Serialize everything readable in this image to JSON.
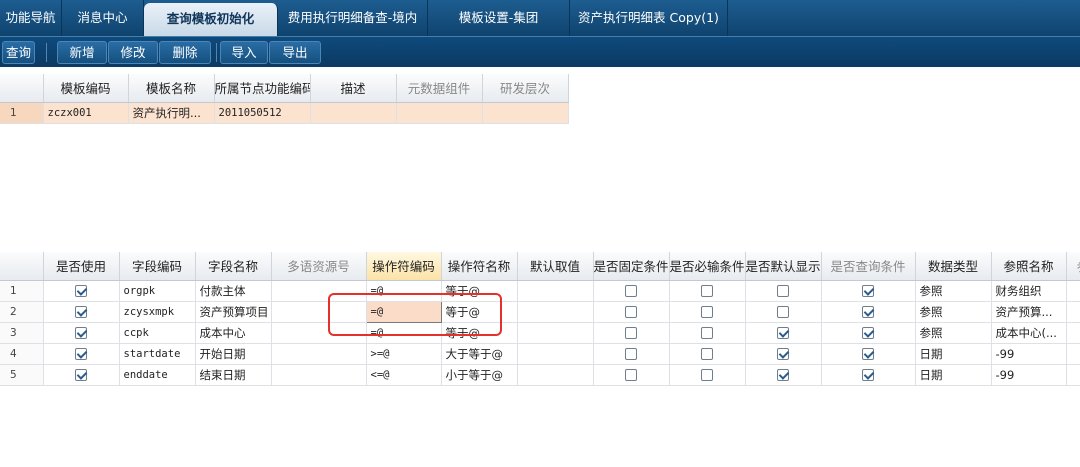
{
  "tabs": [
    {
      "label": "功能导航"
    },
    {
      "label": "消息中心"
    },
    {
      "label": "查询模板初始化",
      "active": true
    },
    {
      "label": "费用执行明细备查-境内"
    },
    {
      "label": "模板设置-集团"
    },
    {
      "label": "资产执行明细表 Copy(1)"
    }
  ],
  "toolbar": {
    "query": "查询",
    "add": "新增",
    "edit": "修改",
    "delete": "删除",
    "import": "导入",
    "export": "导出"
  },
  "template_grid": {
    "headers": [
      "模板编码",
      "模板名称",
      "所属节点功能编码",
      "描述",
      "元数据组件",
      "研发层次"
    ],
    "rows": [
      {
        "num": "1",
        "code": "zczx001",
        "name": "资产执行明...",
        "node": "2011050512",
        "desc": "",
        "meta": "",
        "level": ""
      }
    ]
  },
  "field_grid": {
    "headers": [
      "是否使用",
      "字段编码",
      "字段名称",
      "多语资源号",
      "操作符编码",
      "操作符名称",
      "默认取值",
      "是否固定条件",
      "是否必输条件",
      "是否默认显示",
      "是否查询条件",
      "数据类型",
      "参照名称",
      "参"
    ],
    "rows": [
      {
        "num": "1",
        "used": true,
        "code": "orgpk",
        "name": "付款主体",
        "res": "",
        "op": "=@",
        "opname": "等于@",
        "def": "",
        "fixed": false,
        "required": false,
        "show": false,
        "query": true,
        "type": "参照",
        "ref": "财务组织"
      },
      {
        "num": "2",
        "used": true,
        "code": "zcysxmpk",
        "name": "资产预算项目",
        "res": "",
        "op": "=@",
        "opname": "等于@",
        "def": "",
        "fixed": false,
        "required": false,
        "show": false,
        "query": true,
        "type": "参照",
        "ref": "资产预算..."
      },
      {
        "num": "3",
        "used": true,
        "code": "ccpk",
        "name": "成本中心",
        "res": "",
        "op": "=@",
        "opname": "等于@",
        "def": "",
        "fixed": false,
        "required": false,
        "show": true,
        "query": true,
        "type": "参照",
        "ref": "成本中心(..."
      },
      {
        "num": "4",
        "used": true,
        "code": "startdate",
        "name": "开始日期",
        "res": "",
        "op": ">=@",
        "opname": "大于等于@",
        "def": "",
        "fixed": false,
        "required": false,
        "show": true,
        "query": true,
        "type": "日期",
        "ref": "-99"
      },
      {
        "num": "5",
        "used": true,
        "code": "enddate",
        "name": "结束日期",
        "res": "",
        "op": "<=@",
        "opname": "小于等于@",
        "def": "",
        "fixed": false,
        "required": false,
        "show": true,
        "query": true,
        "type": "日期",
        "ref": "-99"
      }
    ]
  }
}
